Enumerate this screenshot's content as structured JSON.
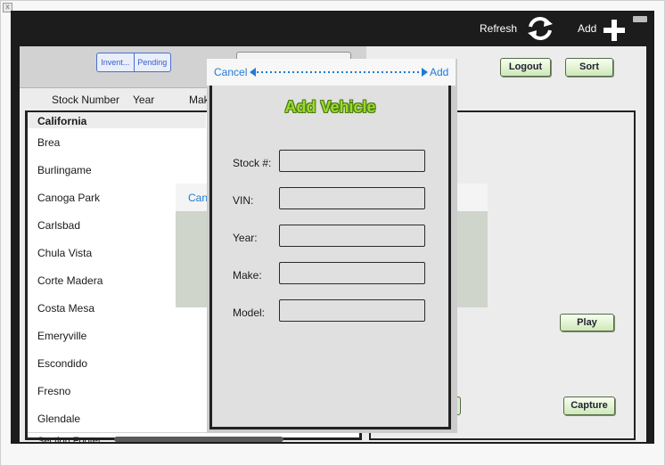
{
  "app_bar": {
    "refresh_label": "Refresh",
    "refresh_icon": "refresh-icon",
    "add_label": "Add",
    "add_icon": "plus-icon"
  },
  "segmented": {
    "options": [
      "Invent...",
      "Pending"
    ]
  },
  "buttons": {
    "logout": "Logout",
    "sort": "Sort",
    "play": "Play",
    "capture": "Capture"
  },
  "columns": [
    "Stock Number",
    "Year",
    "Mak"
  ],
  "table": {
    "section_header": "California",
    "rows": [
      "Brea",
      "Burlingame",
      "Canoga Park",
      "Carlsbad",
      "Chula Vista",
      "Corte Madera",
      "Costa Mesa",
      "Emeryville",
      "Escondido",
      "Fresno",
      "Glendale"
    ],
    "footer": "Section Footer"
  },
  "underlying_sheet": {
    "cancel_label": "Can"
  },
  "modal": {
    "cancel_label": "Cancel",
    "add_label": "Add",
    "title": "Add Vehicle",
    "fields": [
      {
        "label": "Stock #:",
        "value": ""
      },
      {
        "label": "VIN:",
        "value": ""
      },
      {
        "label": "Year:",
        "value": ""
      },
      {
        "label": "Make:",
        "value": ""
      },
      {
        "label": "Model:",
        "value": ""
      }
    ]
  },
  "colors": {
    "accent_blue": "#1f7ad6",
    "title_green": "#9cd92e",
    "button_green": "#cfe8b8",
    "bar_dark": "#1c1c1c"
  }
}
